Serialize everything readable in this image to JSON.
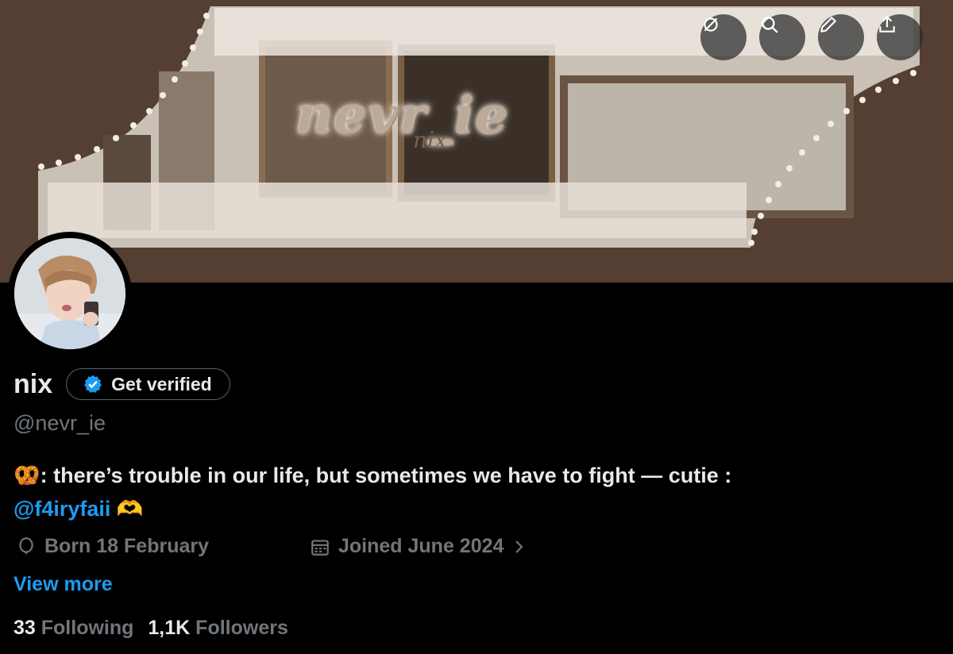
{
  "banner": {
    "title_text": "nevr_ie",
    "sub_text": "nix"
  },
  "header_buttons": [
    {
      "name": "no-sync-button",
      "icon": "no-sync-icon"
    },
    {
      "name": "search-button",
      "icon": "search-icon"
    },
    {
      "name": "edit-button",
      "icon": "pencil-icon"
    },
    {
      "name": "share-button",
      "icon": "share-icon"
    }
  ],
  "profile": {
    "display_name": "nix",
    "verify_label": "Get verified",
    "handle": "@nevr_ie",
    "bio_emoji": "🥨",
    "bio_text": ": there’s trouble in our life, but sometimes we have to fight — cutie :",
    "bio_mention": "@f4iryfaii",
    "bio_emoji_end": "🫶",
    "birthday": "Born 18 February",
    "joined": "Joined June 2024",
    "view_more": "View more"
  },
  "stats": {
    "following_count": "33",
    "following_label": "Following",
    "followers_count": "1,1K",
    "followers_label": "Followers"
  },
  "colors": {
    "accent": "#1d9bf0",
    "secondary_text": "#71767b",
    "banner_bg": "#553f32"
  }
}
